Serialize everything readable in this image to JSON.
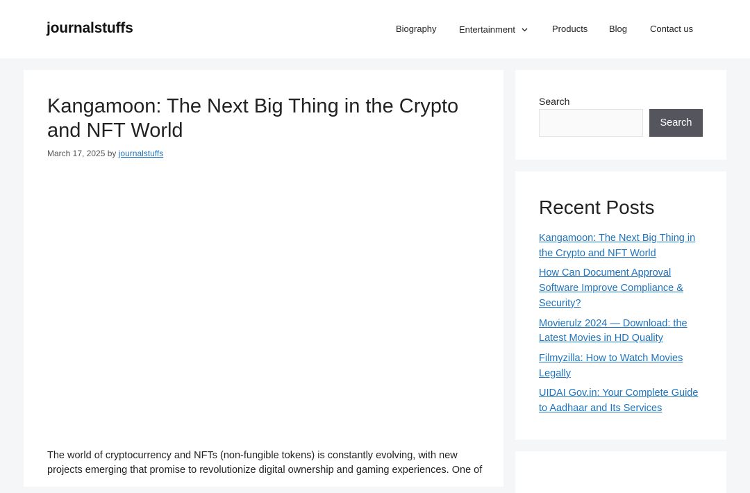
{
  "header": {
    "site_title": "journalstuffs",
    "nav": {
      "biography": "Biography",
      "entertainment": "Entertainment",
      "products": "Products",
      "blog": "Blog",
      "contact": "Contact us"
    }
  },
  "article": {
    "title": "Kangamoon: The Next Big Thing in the Crypto and NFT World",
    "date": "March 17, 2025",
    "by": "by",
    "author": "journalstuffs",
    "body": "The world of cryptocurrency and NFTs (non-fungible tokens) is constantly evolving, with new projects emerging that promise to revolutionize digital ownership and gaming experiences. One of"
  },
  "sidebar": {
    "search": {
      "label": "Search",
      "input_value": "",
      "button_label": "Search"
    },
    "recent_posts": {
      "heading": "Recent Posts",
      "items": [
        {
          "title": "Kangamoon: The Next Big Thing in the Crypto and NFT World"
        },
        {
          "title": "How Can Document Approval Software Improve Compliance & Security?"
        },
        {
          "title": "Movierulz 2024 — Download: the Latest Movies in HD Quality"
        },
        {
          "title": "Filmyzilla: How to Watch Movies Legally"
        },
        {
          "title": "UIDAI Gov.in: Your Complete Guide to Aadhaar and Its Services"
        }
      ]
    }
  },
  "colors": {
    "page_background": "#f5f6f7",
    "link": "#1e73be",
    "search_button": "#55555e"
  },
  "icons": {
    "entertainment_dropdown": "chevron-down-icon"
  }
}
